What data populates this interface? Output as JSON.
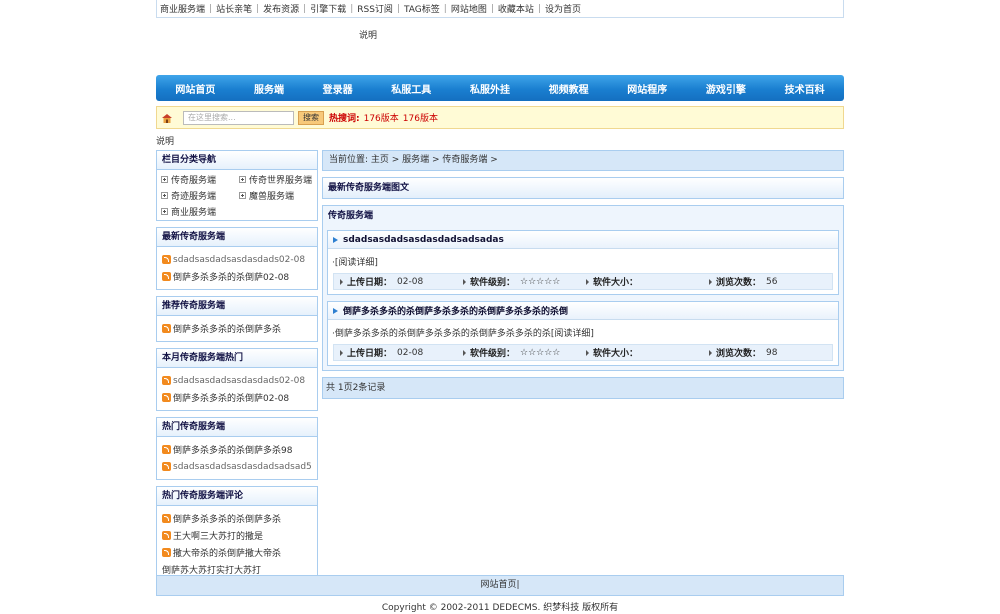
{
  "toplinks": [
    "商业服务端",
    "站长亲笔",
    "发布资源",
    "引擎下载",
    "RSS订阅",
    "TAG标签",
    "网站地图",
    "收藏本站",
    "设为首页"
  ],
  "banner_note": "说明",
  "nav": [
    "网站首页",
    "服务端",
    "登录器",
    "私服工具",
    "私服外挂",
    "视频教程",
    "网站程序",
    "游戏引擎",
    "技术百科"
  ],
  "search": {
    "placeholder": "在这里搜索...",
    "button": "搜索",
    "hot_label": "热搜词:",
    "hot_words": [
      "176版本",
      "176版本"
    ]
  },
  "note2": "说明",
  "left": {
    "category_title": "栏目分类导航",
    "categories": [
      "传奇服务端",
      "传奇世界服务端",
      "奇迹服务端",
      "魔兽服务端",
      "商业服务端"
    ],
    "latest_title": "最新传奇服务端",
    "latest": [
      {
        "text": "sdadsasdadsasdasdads02-08"
      },
      {
        "text": "倒萨多杀多杀的杀倒萨02-08"
      }
    ],
    "recommend_title": "推荐传奇服务端",
    "recommend": [
      {
        "text": "倒萨多杀多杀的杀倒萨多杀"
      }
    ],
    "month_title": "本月传奇服务端热门",
    "month": [
      {
        "text": "sdadsasdadsasdasdads02-08"
      },
      {
        "text": "倒萨多杀多杀的杀倒萨02-08"
      }
    ],
    "hot_title": "热门传奇服务端",
    "hot": [
      {
        "text": "倒萨多杀多杀的杀倒萨多杀98"
      },
      {
        "text": "sdadsasdadsasdasdadsadsad5"
      }
    ],
    "comments_title": "热门传奇服务端评论",
    "comments": [
      {
        "text": "倒萨多杀多杀的杀倒萨多杀"
      },
      {
        "text": "王大啊三大苏打的撒是"
      },
      {
        "text": "撒大帝杀的杀倒萨撒大帝杀"
      },
      {
        "text": "倒萨苏大苏打实打大苏打"
      }
    ]
  },
  "breadcrumb": "当前位置: 主页 > 服务端 > 传奇服务端 >",
  "latest_pic_title": "最新传奇服务端图文",
  "list_title": "传奇服务端",
  "articles": [
    {
      "title": "sdadsasdadsasdasdadsadsadas",
      "desc": "·[阅读详细]",
      "date_label": "上传日期：",
      "date": "02-08",
      "level_label": "软件级别：",
      "level": "☆☆☆☆☆",
      "size_label": "软件大小：",
      "size": "",
      "views_label": "浏览次数：",
      "views": "56"
    },
    {
      "title": "倒萨多杀多杀的杀倒萨多杀多杀的杀倒萨多杀多杀的杀倒",
      "desc": "·倒萨多杀多杀的杀倒萨多杀多杀的杀倒萨多杀多杀的杀[阅读详细]",
      "date_label": "上传日期：",
      "date": "02-08",
      "level_label": "软件级别：",
      "level": "☆☆☆☆☆",
      "size_label": "软件大小：",
      "size": "",
      "views_label": "浏览次数：",
      "views": "98"
    }
  ],
  "pager": "共 1页2条记录",
  "footer": "网站首页|",
  "copyright": "Copyright © 2002-2011 DEDECMS. 织梦科技 版权所有"
}
